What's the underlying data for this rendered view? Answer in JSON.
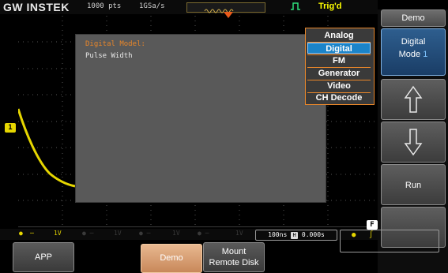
{
  "header": {
    "brand": "GW INSTEK",
    "record_length": "1000 pts",
    "sample_rate": "1GSa/s",
    "trigger_status": "Trig'd"
  },
  "dialog": {
    "title": "Digital Model:",
    "subtitle": "Pulse Width"
  },
  "popup_menu": {
    "items": [
      {
        "label": "Analog",
        "selected": false
      },
      {
        "label": "Digital",
        "selected": true
      },
      {
        "label": "FM",
        "selected": false
      },
      {
        "label": "Generator",
        "selected": false
      },
      {
        "label": "Video",
        "selected": false
      },
      {
        "label": "CH Decode",
        "selected": false
      }
    ]
  },
  "right_panel": {
    "title": "Demo",
    "mode_name": "Digital",
    "mode_label": "Mode",
    "mode_value": "1",
    "run_label": "Run"
  },
  "status_line": {
    "ch1_marker": "1",
    "ch1_scale": "1V",
    "ch2_scale": "1V",
    "ch3_scale": "1V",
    "ch4_scale": "1V",
    "timebase": "100ns",
    "time_offset": "0.000s",
    "f_badge": "F"
  },
  "bottom_menu": {
    "app_label": "APP",
    "demo_label": "Demo",
    "mount_label_line1": "Mount",
    "mount_label_line2": "Remote Disk"
  },
  "colors": {
    "ch1": "#e6d600",
    "accent_orange": "#e8862a",
    "selection_blue": "#1b84c9"
  }
}
